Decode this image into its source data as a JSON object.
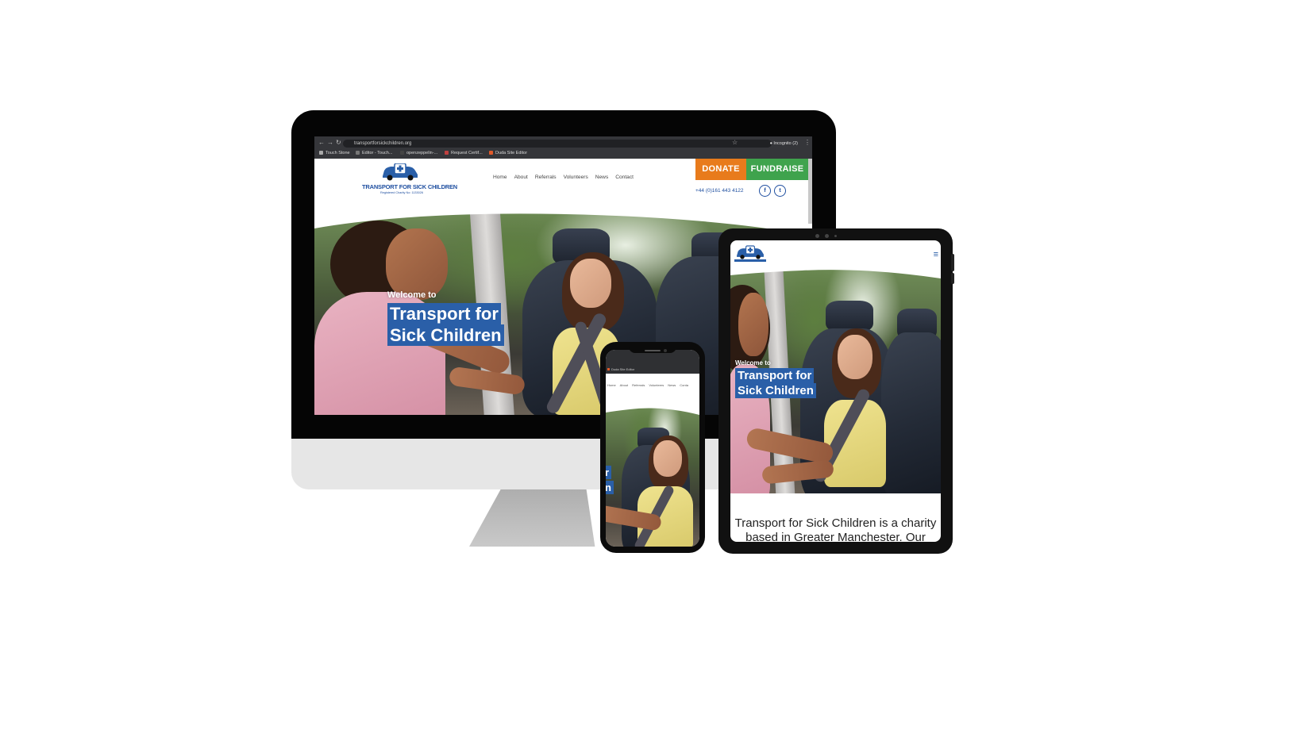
{
  "desktop": {
    "browser": {
      "url": "transportforsickchildren.org",
      "bookmarks": [
        "Touch Stone",
        "Editor - Touch...",
        "openzeppelin-...",
        "Request Certif...",
        "Duda Site Editor"
      ],
      "profile": "Incognito (2)"
    },
    "site": {
      "logo_text": "TRANSPORT FOR SICK CHILDREN",
      "logo_sub": "Registered Charity No: 1133026",
      "nav": [
        "Home",
        "About",
        "Referrals",
        "Volunteers",
        "News",
        "Contact"
      ],
      "donate_label": "DONATE",
      "fundraise_label": "FUNDRAISE",
      "phone": "+44 (0)161 443 4122",
      "social": [
        "f",
        "t"
      ],
      "hero_welcome": "Welcome to",
      "hero_title_line1": "Transport for",
      "hero_title_line2": "Sick Children"
    }
  },
  "tablet": {
    "hero_welcome": "Welcome to",
    "hero_title_line1": "Transport for",
    "hero_title_line2": "Sick Children",
    "intro_line1": "Transport for Sick Children is a charity",
    "intro_line2": "based in Greater Manchester. Our"
  },
  "phone": {
    "editor_label": "Duda Site Editor",
    "nav": [
      "Home",
      "About",
      "Referrals",
      "Volunteers",
      "News",
      "Conta"
    ],
    "hero_fragment_1": "r",
    "hero_fragment_2": "n"
  },
  "colors": {
    "brand_blue": "#2a5fa8",
    "donate_orange": "#e87b1c",
    "fundraise_green": "#3fa34d"
  }
}
